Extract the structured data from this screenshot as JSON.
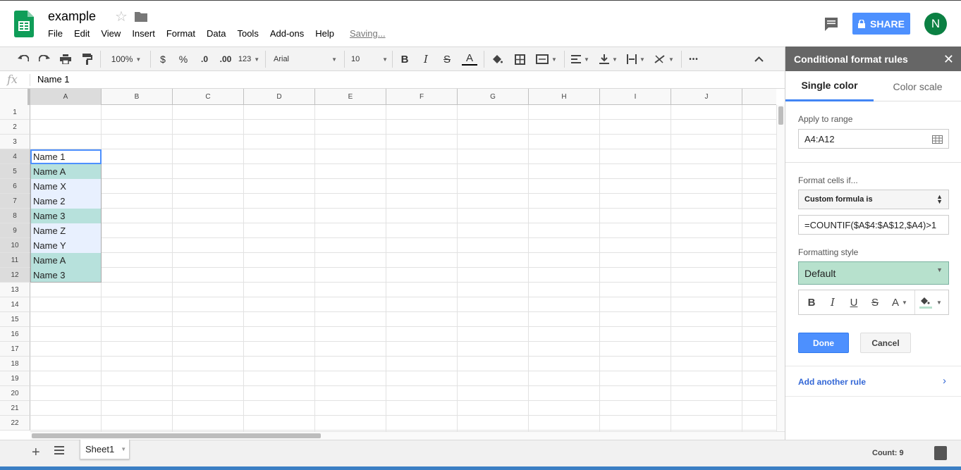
{
  "app": {
    "title": "example",
    "saving_status": "Saving...",
    "menus": [
      "File",
      "Edit",
      "View",
      "Insert",
      "Format",
      "Data",
      "Tools",
      "Add-ons",
      "Help"
    ],
    "share_label": "SHARE",
    "avatar_initial": "N",
    "brand_color": "#0f9d58",
    "accent": "#4d90fe"
  },
  "toolbar": {
    "zoom": "100%",
    "currency": "$",
    "percent": "%",
    "decrease_decimals": ".0",
    "increase_decimals": ".00",
    "more_formats": "123",
    "font": "Arial",
    "font_size": "10",
    "bold": "B",
    "italic": "I",
    "strikethrough": "S",
    "text_color": "A",
    "more": "•••"
  },
  "formula_bar": {
    "fx": "fx",
    "value": "Name 1"
  },
  "grid": {
    "columns": [
      "A",
      "B",
      "C",
      "D",
      "E",
      "F",
      "G",
      "H",
      "I",
      "J"
    ],
    "rows": [
      "1",
      "2",
      "3",
      "4",
      "5",
      "6",
      "7",
      "8",
      "9",
      "10",
      "11",
      "12",
      "13",
      "14",
      "15",
      "16",
      "17",
      "18",
      "19",
      "20",
      "21",
      "22"
    ],
    "cells": [
      {
        "row": "4",
        "value": "Name 1",
        "style": "selected"
      },
      {
        "row": "5",
        "value": "Name A",
        "style": "duplicate"
      },
      {
        "row": "6",
        "value": "Name X",
        "style": "range"
      },
      {
        "row": "7",
        "value": "Name 2",
        "style": "range"
      },
      {
        "row": "8",
        "value": "Name 3",
        "style": "duplicate"
      },
      {
        "row": "9",
        "value": "Name Z",
        "style": "range"
      },
      {
        "row": "10",
        "value": "Name Y",
        "style": "range"
      },
      {
        "row": "11",
        "value": "Name A",
        "style": "duplicate"
      },
      {
        "row": "12",
        "value": "Name 3",
        "style": "duplicate"
      }
    ],
    "duplicate_color": "#b7e1dc",
    "range_color": "#e8f0fe"
  },
  "bottom": {
    "sheet_tab": "Sheet1",
    "count": "Count: 9"
  },
  "panel": {
    "title": "Conditional format rules",
    "tabs": [
      "Single color",
      "Color scale"
    ],
    "active_tab": "Single color",
    "apply_label": "Apply to range",
    "range_value": "A4:A12",
    "format_if_label": "Format cells if...",
    "condition": "Custom formula is",
    "formula": "=COUNTIF($A$4:$A$12,$A4)>1",
    "style_label": "Formatting style",
    "style_value": "Default",
    "style_buttons": [
      "B",
      "I",
      "U",
      "S",
      "A"
    ],
    "done_label": "Done",
    "cancel_label": "Cancel",
    "add_rule_label": "Add another rule",
    "header_color": "#666666",
    "style_fill": "#b7e1cd"
  }
}
